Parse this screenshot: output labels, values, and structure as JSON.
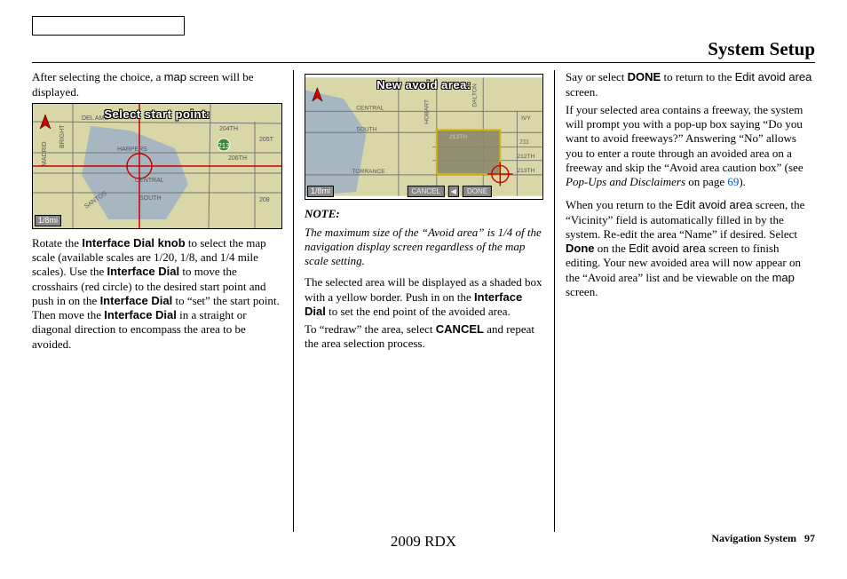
{
  "page_title": "System Setup",
  "footer": {
    "model": "2009  RDX",
    "section": "Navigation System",
    "page_no": "97"
  },
  "link_page": "69",
  "map1": {
    "title": "Select start point:",
    "scale": "1/8mi",
    "streets": {
      "s1": "DEL AMO",
      "s2": "HARPERS",
      "s3": "CENTRAL",
      "s4": "SOUTH",
      "s5": "MADRID",
      "s6": "SANTOS",
      "s7": "BRIGHT",
      "s8": "204TH",
      "s9": "205T",
      "s10": "206TH",
      "s11": "208"
    },
    "marker": "213"
  },
  "map2": {
    "title": "New avoid area:",
    "scale": "1/8mi",
    "streets": {
      "s1": "CENTRAL",
      "s2": "SOUTH",
      "s3": "TORRANCE",
      "s4": "HOBART",
      "s5": "DALTON",
      "s6": "IVY",
      "s7": "211",
      "s8": "212TH",
      "s9": "213TH",
      "s10": "213TH"
    },
    "buttons": {
      "cancel": "CANCEL",
      "done": "DONE"
    }
  },
  "col1": {
    "p1a": "After selecting the choice, a ",
    "p1b": "map",
    "p1c": " screen will be displayed.",
    "p2a": "Rotate the ",
    "p2b": "Interface Dial knob",
    "p2c": " to select the map scale (available scales are 1/20, 1/8, and 1/4 mile scales). Use the ",
    "p2d": "Interface Dial",
    "p2e": " to move the crosshairs (red circle) to the desired start point and push in on the ",
    "p2f": "Interface Dial",
    "p2g": " to “set” the start point. Then move the ",
    "p2h": "Interface Dial",
    "p2i": " in a straight or diagonal direction to encompass the area to be avoided."
  },
  "col2": {
    "note_label": "NOTE:",
    "note": "The maximum size of the “Avoid area” is 1/4 of the navigation display screen regardless of the map scale setting.",
    "p1a": "The selected area will be displayed as a shaded box with a yellow border. Push in on the ",
    "p1b": "Interface Dial",
    "p1c": " to set the end point of the avoided area.",
    "p2a": "To “redraw” the area, select ",
    "p2b": "CANCEL",
    "p2c": " and repeat the area selection process."
  },
  "col3": {
    "p1a": "Say or select ",
    "p1b": "DONE",
    "p1c": " to return to the ",
    "p1d": "Edit avoid area",
    "p1e": " screen.",
    "p2a": "If your selected area contains a freeway, the system will prompt you with a pop-up box saying “Do you want to avoid freeways?” Answering “No” allows you to enter a route through an avoided area on a freeway and skip the “Avoid area caution box” (see ",
    "p2b": "Pop-Ups and Disclaimers",
    "p2c": " on page ",
    "p2d": ").",
    "p3a": "When you return to the ",
    "p3b": "Edit avoid area",
    "p3c": " screen, the “Vicinity” field is automatically filled in by the system. Re-edit the area “Name” if desired. Select ",
    "p3d": "Done",
    "p3e": " on the ",
    "p3f": "Edit avoid area",
    "p3g": " screen to finish editing. Your new avoided area will now appear on the “Avoid area” list and be viewable on the ",
    "p3h": "map",
    "p3i": " screen."
  }
}
